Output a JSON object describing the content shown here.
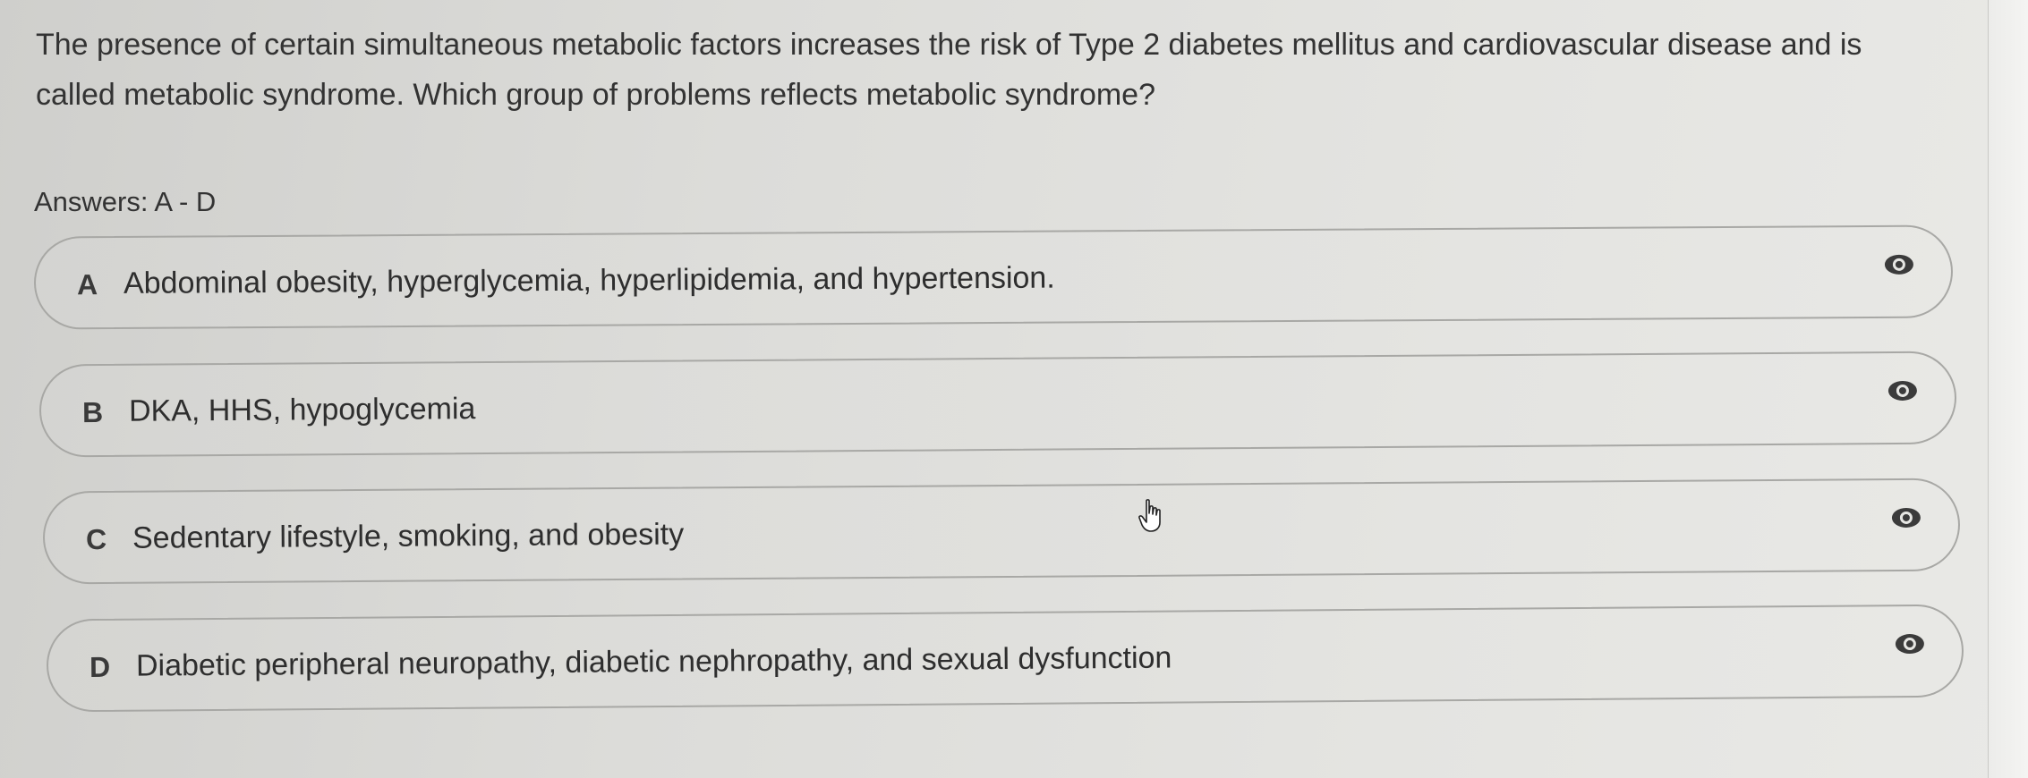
{
  "question": {
    "text": "The presence of certain simultaneous metabolic factors increases the risk of Type 2 diabetes mellitus and cardiovascular disease and is called metabolic syndrome. Which group of problems reflects metabolic syndrome?"
  },
  "answers": {
    "label": "Answers: A - D",
    "options": [
      {
        "letter": "A",
        "text": "Abdominal obesity, hyperglycemia, hyperlipidemia, and hypertension.",
        "icon": "eye-icon"
      },
      {
        "letter": "B",
        "text": "DKA, HHS, hypoglycemia",
        "icon": "eye-icon"
      },
      {
        "letter": "C",
        "text": "Sedentary lifestyle, smoking, and obesity",
        "icon": "eye-icon"
      },
      {
        "letter": "D",
        "text": "Diabetic peripheral neuropathy, diabetic nephropathy, and sexual dysfunction",
        "icon": "eye-icon"
      }
    ]
  },
  "pointer": {
    "icon": "hand-pointer-icon"
  }
}
